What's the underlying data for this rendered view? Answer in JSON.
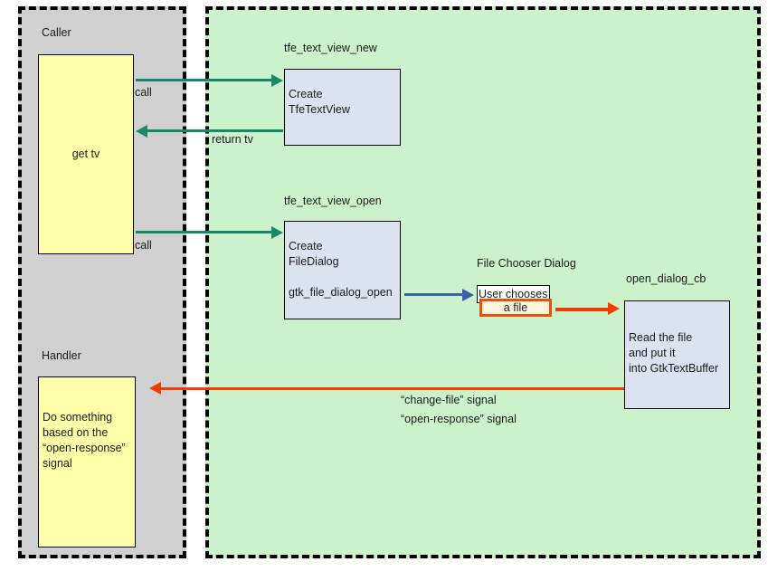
{
  "diagram": {
    "regions": [
      {
        "id": "caller",
        "label": "Caller",
        "fill": "#d0d0d0"
      },
      {
        "id": "handler",
        "label": "Handler",
        "fill": "#d0d0d0"
      },
      {
        "id": "library",
        "label": "",
        "fill": "#ccf2cc"
      }
    ],
    "boxes": {
      "get_tv": {
        "text": "get tv"
      },
      "handler_action": {
        "text": "Do something\nbased on the\n“open-response”\nsignal"
      },
      "create_tfetextview": {
        "text": "Create\nTfeTextView"
      },
      "create_filedialog": {
        "text": "Create\nFileDialog"
      },
      "gtk_file_dialog_open": {
        "text": "gtk_file_dialog_open"
      },
      "user_chooses": {
        "text": "User chooses"
      },
      "a_file": {
        "text": "a file"
      },
      "read_file": {
        "text": "Read the file\nand put it\ninto GtkTextBuffer"
      }
    },
    "captions": {
      "tfe_text_view_new": "tfe_text_view_new",
      "tfe_text_view_open": "tfe_text_view_open",
      "file_chooser_dialog": "File Chooser Dialog",
      "open_dialog_cb": "open_dialog_cb"
    },
    "arrow_labels": {
      "call_1": "call",
      "return_tv": "return tv",
      "call_2": "call",
      "signals": "“change-file” signal\n“open-response” signal"
    },
    "colors": {
      "caller_fill": "#d0d0d0",
      "library_fill": "#ccf2cc",
      "yellow_box": "#ffffaa",
      "blue_box": "#dce3f0",
      "cream_box": "#fdf6dd",
      "teal_arrow": "#18876a",
      "blue_arrow": "#3b62a8",
      "red_arrow": "#f03c02",
      "orange_border": "#e8520e",
      "border": "#000000"
    }
  }
}
